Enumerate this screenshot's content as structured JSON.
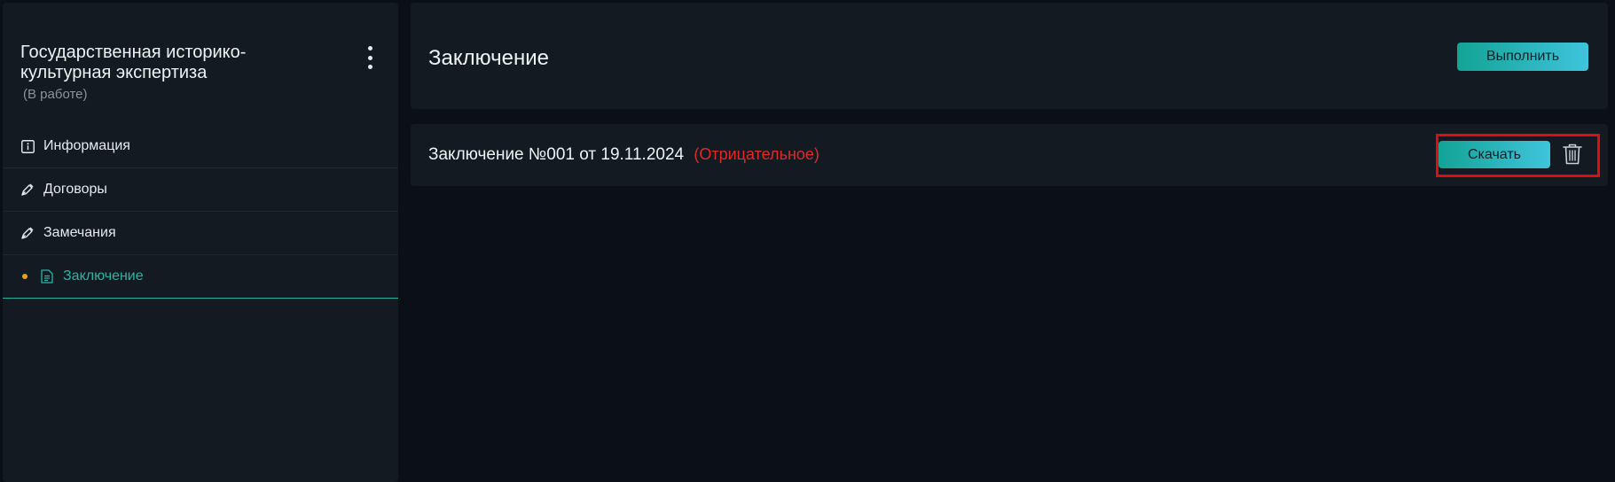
{
  "sidebar": {
    "project_title": "Государственная историко-культурная экспертиза",
    "project_status": "(В работе)",
    "menu": [
      {
        "label": "Информация",
        "icon": "info-icon"
      },
      {
        "label": "Договоры",
        "icon": "pen-icon"
      },
      {
        "label": "Замечания",
        "icon": "pen-icon"
      },
      {
        "label": "Заключение",
        "icon": "document-icon",
        "active": true
      }
    ]
  },
  "header": {
    "title": "Заключение",
    "execute_label": "Выполнить"
  },
  "conclusion": {
    "text": "Заключение №001 от 19.11.2024",
    "status": "(Отрицательное)",
    "download_label": "Скачать"
  },
  "colors": {
    "accent": "#22b3a3",
    "negative": "#e02a2a",
    "active_dot": "#e3a21a",
    "highlight": "#e10d0d"
  }
}
